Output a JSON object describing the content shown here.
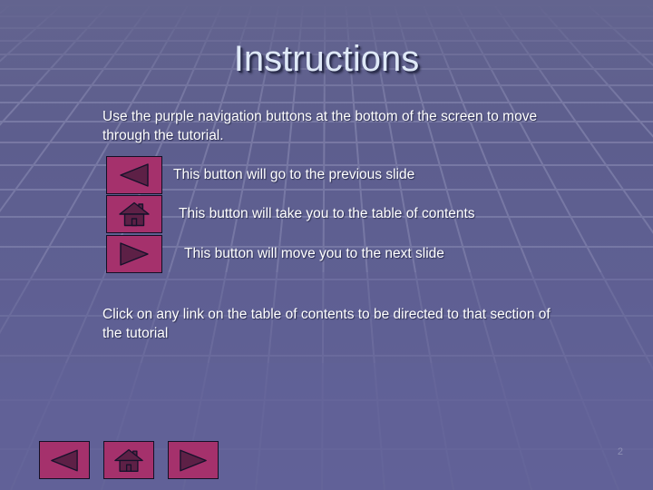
{
  "slide": {
    "title": "Instructions",
    "page_number": "2",
    "intro_text": "Use the purple navigation buttons at the bottom of the screen to move through the tutorial.",
    "closing_text": "Click on any link on the table of contents to be directed to that section of the tutorial",
    "button_rows": [
      {
        "icon": "previous-slide-triangle-icon",
        "label": "This button will go to the previous slide"
      },
      {
        "icon": "home-house-icon",
        "label": "This button will take you to the table of contents"
      },
      {
        "icon": "next-slide-triangle-icon",
        "label": "This button will move you to the next slide"
      }
    ],
    "bottom_nav": [
      {
        "icon": "previous-slide-triangle-icon",
        "name": "previous-slide-button"
      },
      {
        "icon": "home-house-icon",
        "name": "home-button"
      },
      {
        "icon": "next-slide-triangle-icon",
        "name": "next-slide-button"
      }
    ],
    "colors": {
      "background_purple": "#5f5f92",
      "button_magenta": "#a5316c",
      "button_glyph_dark": "#5d2046",
      "button_border": "#121026",
      "title_text": "#dfe9f7",
      "title_shadow": "#2b2e4e",
      "body_text": "#ffffff",
      "page_number_text": "#8d8fb4",
      "grid_line": "#8b8cb3"
    }
  }
}
